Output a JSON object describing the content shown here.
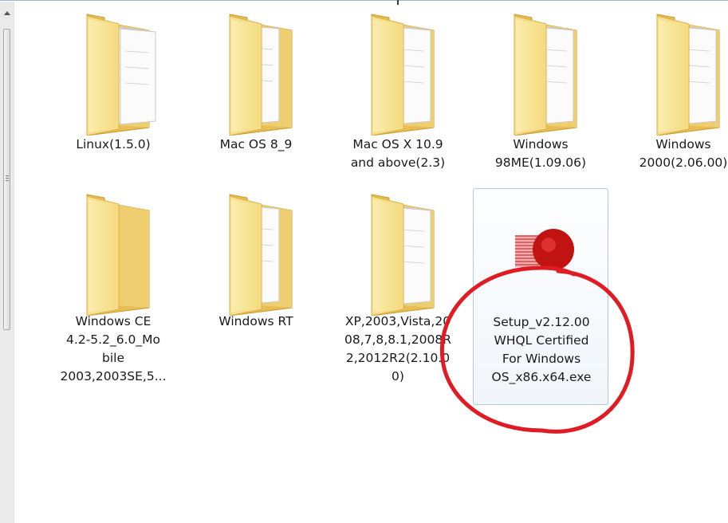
{
  "items": [
    {
      "name": "Linux(1.5.0)",
      "lines": [
        "Linux(1.5.0)"
      ],
      "type": "folder"
    },
    {
      "name": "Mac OS 8_9",
      "lines": [
        "Mac OS 8_9"
      ],
      "type": "folder"
    },
    {
      "name": "Mac OS X 10.9 and above(2.3)",
      "lines": [
        "Mac OS X 10.9",
        "and above(2.3)"
      ],
      "type": "folder"
    },
    {
      "name": "Windows 98ME(1.09.06)",
      "lines": [
        "Windows",
        "98ME(1.09.06)"
      ],
      "type": "folder"
    },
    {
      "name": "Windows 2000(2.06.00)",
      "lines": [
        "Windows",
        "2000(2.06.00)"
      ],
      "type": "folder"
    },
    {
      "name": "Windows CE 4.2-5.2_6.0_Mobile 2003,2003SE,5...",
      "lines": [
        "Windows CE",
        "4.2-5.2_6.0_Mo",
        "bile",
        "2003,2003SE,5..."
      ],
      "type": "folder"
    },
    {
      "name": "Windows RT",
      "lines": [
        "Windows RT"
      ],
      "type": "folder"
    },
    {
      "name": "XP,2003,Vista,2008,7,8,8.1,2008R2,2012R2(2.10.00)",
      "lines": [
        "XP,2003,Vista,20",
        "08,7,8,8.1,2008R",
        "2,2012R2(2.10.0",
        "0)"
      ],
      "type": "folder"
    },
    {
      "name": "Setup_v2.12.00 WHQL Certified For Windows OS_x86.x64.exe",
      "lines": [
        "Setup_v2.12.00",
        "WHQL Certified",
        "For Windows",
        "OS_x86.x64.exe"
      ],
      "type": "exe",
      "selected": true
    }
  ],
  "colors": {
    "folder_back": "#e7bd54",
    "folder_front": "#f6df8a",
    "annotation": "#e01b24",
    "selection_border": "#b4c8de"
  },
  "icons": {
    "scroll_up": "triangle-up-icon",
    "folder": "folder-icon",
    "exe": "exe-app-icon"
  }
}
